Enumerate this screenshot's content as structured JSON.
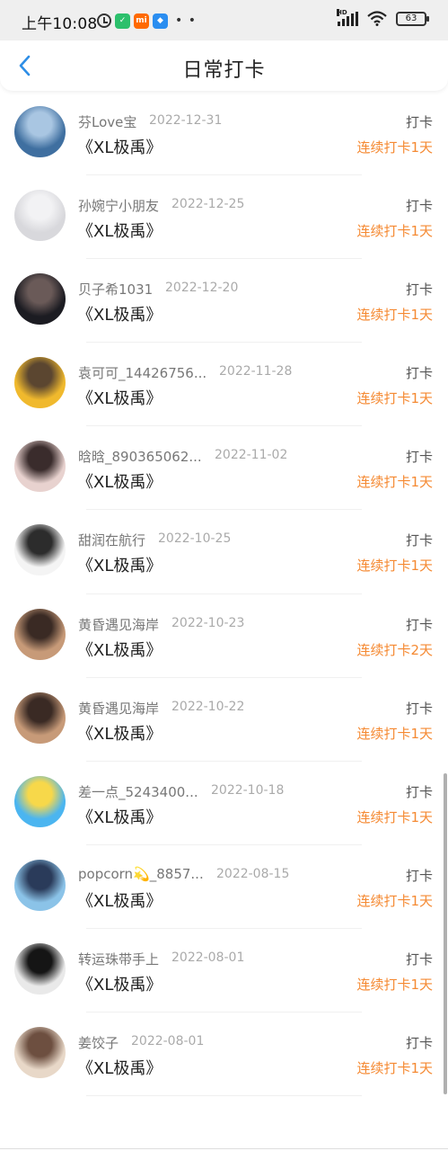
{
  "status_bar": {
    "time": "上午10:08",
    "app_chips": [
      {
        "name": "wechat-icon",
        "label": "✓",
        "color": "#2cc06c"
      },
      {
        "name": "mi-icon",
        "label": "mi",
        "color": "#ff6a00"
      },
      {
        "name": "app-icon",
        "label": "◆",
        "color": "#2b8ef0"
      }
    ],
    "signal_label": "HD",
    "battery": "63"
  },
  "header": {
    "title": "日常打卡",
    "back_icon": "chevron-left-icon",
    "accent_color": "#2e8ee6"
  },
  "colors": {
    "streak": "#f58a33"
  },
  "records": [
    {
      "user": "芬Love宝",
      "date": "2022-12-31",
      "book": "《XL极禹》",
      "tag": "打卡",
      "streak": "连续打卡1天",
      "avatar_colors": [
        "#3f6fa0",
        "#a9c6e2"
      ]
    },
    {
      "user": "孙婉宁小朋友",
      "date": "2022-12-25",
      "book": "《XL极禹》",
      "tag": "打卡",
      "streak": "连续打卡1天",
      "avatar_colors": [
        "#d8d8dc",
        "#f2f2f4"
      ]
    },
    {
      "user": "贝子希1031",
      "date": "2022-12-20",
      "book": "《XL极禹》",
      "tag": "打卡",
      "streak": "连续打卡1天",
      "avatar_colors": [
        "#1c1c22",
        "#6a5a58"
      ]
    },
    {
      "user": "袁可可_14426756...",
      "date": "2022-11-28",
      "book": "《XL极禹》",
      "tag": "打卡",
      "streak": "连续打卡1天",
      "avatar_colors": [
        "#f0b92d",
        "#5b4630"
      ]
    },
    {
      "user": "晗晗_890365062...",
      "date": "2022-11-02",
      "book": "《XL极禹》",
      "tag": "打卡",
      "streak": "连续打卡1天",
      "avatar_colors": [
        "#e8d2cf",
        "#3a2c2c"
      ]
    },
    {
      "user": "甜润在航行",
      "date": "2022-10-25",
      "book": "《XL极禹》",
      "tag": "打卡",
      "streak": "连续打卡1天",
      "avatar_colors": [
        "#f4f4f4",
        "#2c2c2c"
      ]
    },
    {
      "user": "黄昏遇见海岸",
      "date": "2022-10-23",
      "book": "《XL极禹》",
      "tag": "打卡",
      "streak": "连续打卡2天",
      "avatar_colors": [
        "#c79a78",
        "#3a2a24"
      ]
    },
    {
      "user": "黄昏遇见海岸",
      "date": "2022-10-22",
      "book": "《XL极禹》",
      "tag": "打卡",
      "streak": "连续打卡1天",
      "avatar_colors": [
        "#c79a78",
        "#3a2a24"
      ]
    },
    {
      "user": "差一点_5243400...",
      "date": "2022-10-18",
      "book": "《XL极禹》",
      "tag": "打卡",
      "streak": "连续打卡1天",
      "avatar_colors": [
        "#4bb5f0",
        "#f7d84a"
      ]
    },
    {
      "user": "popcorn💫_8857...",
      "date": "2022-08-15",
      "book": "《XL极禹》",
      "tag": "打卡",
      "streak": "连续打卡1天",
      "avatar_colors": [
        "#8bc3e8",
        "#2a3b5a"
      ]
    },
    {
      "user": "转运珠带手上",
      "date": "2022-08-01",
      "book": "《XL极禹》",
      "tag": "打卡",
      "streak": "连续打卡1天",
      "avatar_colors": [
        "#e9e9e9",
        "#151515"
      ]
    },
    {
      "user": "姜饺子",
      "date": "2022-08-01",
      "book": "《XL极禹》",
      "tag": "打卡",
      "streak": "连续打卡1天",
      "avatar_colors": [
        "#e8d8c8",
        "#6d4f40"
      ]
    }
  ]
}
